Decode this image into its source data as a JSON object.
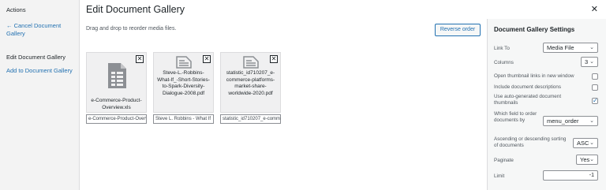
{
  "menu": {
    "heading": "Actions",
    "cancel": "← Cancel Document Gallery",
    "active": "Edit Document Gallery",
    "add": "Add to Document Gallery"
  },
  "header": {
    "title": "Edit Document Gallery",
    "close": "✕"
  },
  "main": {
    "help": "Drag and drop to reorder media files.",
    "reverse_label": "Reverse order",
    "attachments": [
      {
        "title": "e-Commerce-Product-Overview.xls",
        "caption": "e-Commerce-Product-Overview",
        "icon": "spreadsheet-icon"
      },
      {
        "title": "Steve-L.-Robbins-What-If_-Short-Stories-to-Spark-Diversity-Dialogue-2008.pdf",
        "caption": "Steve L. Robbins - What If",
        "icon": "document-icon"
      },
      {
        "title": "statistic_id710207_e-commerce-platforms-market-share-worldwide-2020.pdf",
        "caption": "statistic_id710207_e-commerce",
        "icon": "document-icon"
      }
    ],
    "remove": "✕"
  },
  "settings": {
    "heading": "Document Gallery Settings",
    "link_to": {
      "label": "Link To",
      "value": "Media File"
    },
    "columns": {
      "label": "Columns",
      "value": "3"
    },
    "open_new_window": {
      "label": "Open thumbnail links in new window",
      "checked": false
    },
    "include_desc": {
      "label": "Include document descriptions",
      "checked": false
    },
    "auto_thumbs": {
      "label": "Use auto-generated document thumbnails",
      "checked": true
    },
    "order_field": {
      "label": "Which field to order documents by",
      "value": "menu_order"
    },
    "sort_dir": {
      "label": "Ascending or descending sorting of documents",
      "value": "ASC"
    },
    "paginate": {
      "label": "Paginate",
      "value": "Yes"
    },
    "limit": {
      "label": "Limit",
      "value": "-1"
    },
    "chevron": "⌄",
    "tick": "✓"
  }
}
